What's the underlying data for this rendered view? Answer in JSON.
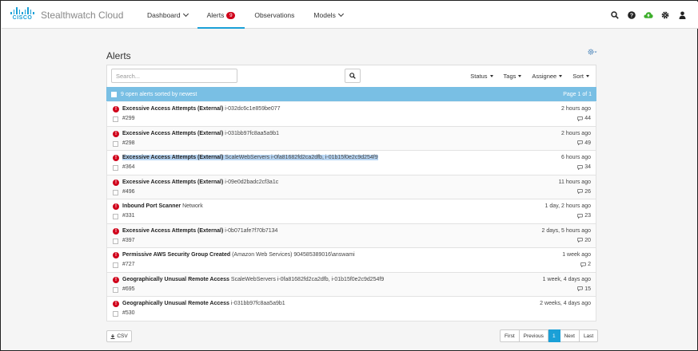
{
  "app": {
    "logo_text": "CISCO",
    "title": "Stealthwatch Cloud"
  },
  "nav": {
    "items": [
      {
        "label": "Dashboard",
        "dropdown": true
      },
      {
        "label": "Alerts",
        "badge": "9",
        "active": true
      },
      {
        "label": "Observations"
      },
      {
        "label": "Models",
        "dropdown": true
      }
    ],
    "icons": [
      "search-icon",
      "help-icon",
      "cloud-upload-icon",
      "gear-icon",
      "user-icon"
    ]
  },
  "page": {
    "title": "Alerts"
  },
  "toolbar": {
    "search_placeholder": "Search...",
    "filters": [
      "Status",
      "Tags",
      "Assignee",
      "Sort"
    ]
  },
  "list": {
    "summary": "9 open alerts sorted by newest",
    "page_info": "Page 1 of 1",
    "alerts": [
      {
        "title": "Excessive Access Attempts (External)",
        "subject": "i-032dc6c1e859be077",
        "id": "#299",
        "time": "2 hours ago",
        "comments": "44"
      },
      {
        "title": "Excessive Access Attempts (External)",
        "subject": "i-031bb97fc8aa5a9b1",
        "id": "#298",
        "time": "2 hours ago",
        "comments": "49"
      },
      {
        "title": "Excessive Access Attempts (External)",
        "subject": "ScaleWebServers i-0fa81682fd2ca2dfb, i-01b15f0e2c9d254f9",
        "id": "#364",
        "time": "6 hours ago",
        "comments": "34",
        "highlighted": true
      },
      {
        "title": "Excessive Access Attempts (External)",
        "subject": "i-09e0d2badc2cf3a1c",
        "id": "#496",
        "time": "11 hours ago",
        "comments": "26"
      },
      {
        "title": "Inbound Port Scanner",
        "subject": "Network",
        "id": "#331",
        "time": "1 day, 2 hours ago",
        "comments": "23"
      },
      {
        "title": "Excessive Access Attempts (External)",
        "subject": "i-0b071afe7f70b7134",
        "id": "#397",
        "time": "2 days, 5 hours ago",
        "comments": "20"
      },
      {
        "title": "Permissive AWS Security Group Created",
        "subject": "(Amazon Web Services) 904585389016\\answami",
        "id": "#727",
        "time": "1 week ago",
        "comments": "2"
      },
      {
        "title": "Geographically Unusual Remote Access",
        "subject": "ScaleWebServers i-0fa81682fd2ca2dfb, i-01b15f0e2c9d254f9",
        "id": "#695",
        "time": "1 week, 4 days ago",
        "comments": "15"
      },
      {
        "title": "Geographically Unusual Remote Access",
        "subject": "i-031bb97fc8aa5a9b1",
        "id": "#530",
        "time": "2 weeks, 4 days ago",
        "comments": ""
      }
    ]
  },
  "footer": {
    "csv_label": "CSV",
    "pager": [
      "First",
      "Previous",
      "1",
      "Next",
      "Last"
    ],
    "current_page": "1"
  },
  "colors": {
    "accent": "#1ba0d7",
    "alert": "#d0021b",
    "list_header": "#79bfe4",
    "upload_icon": "#3dae2b"
  }
}
